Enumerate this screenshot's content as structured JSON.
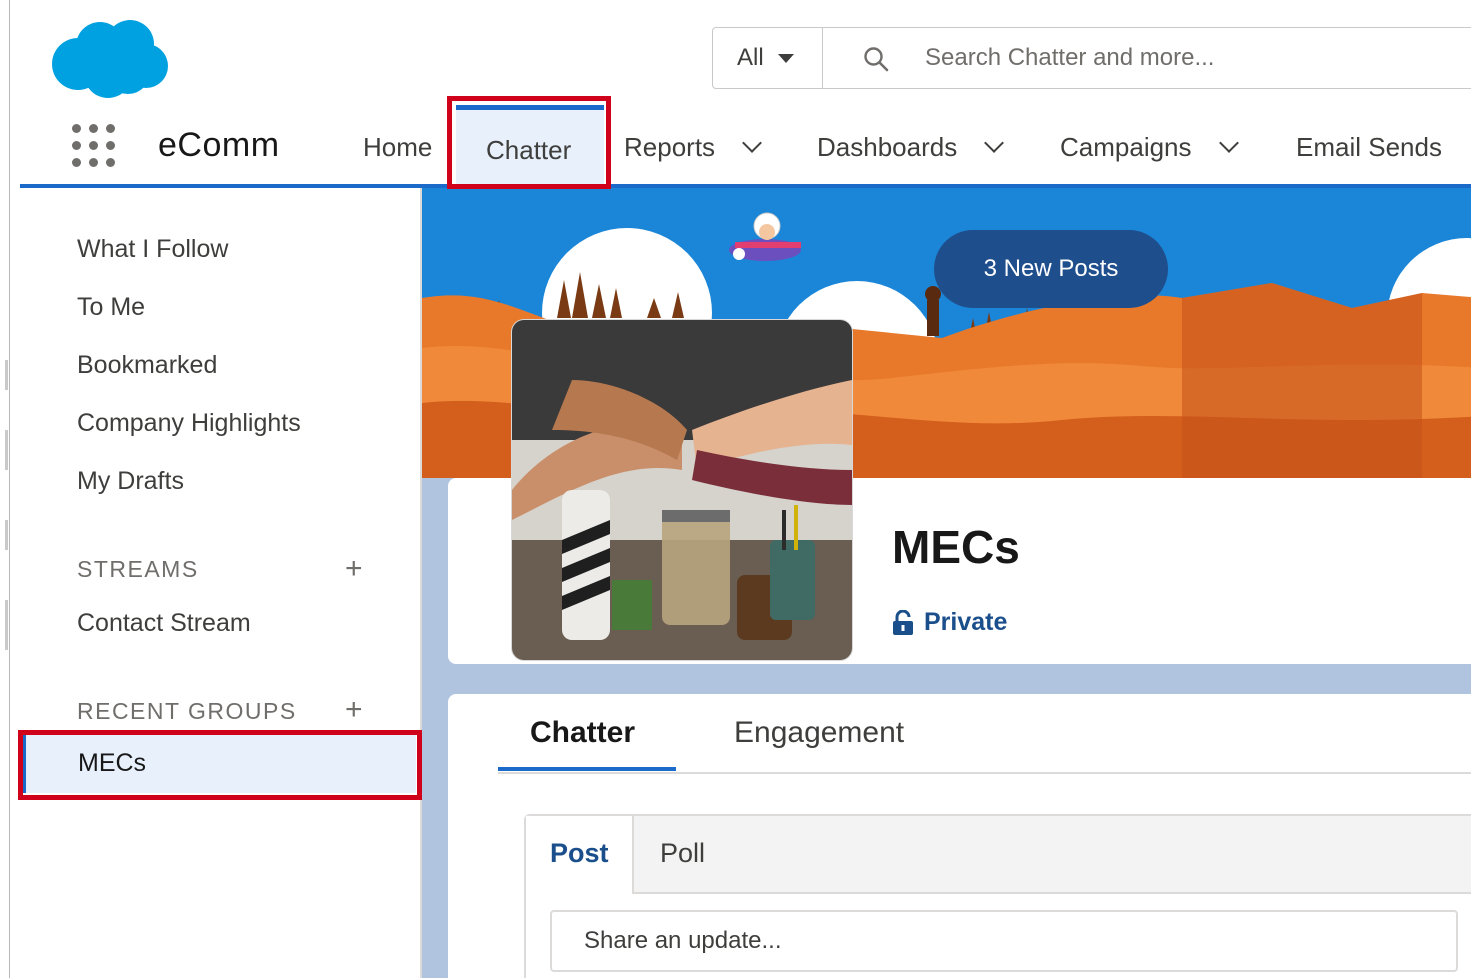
{
  "header": {
    "search_scope": "All",
    "search_placeholder": "Search Chatter and more..."
  },
  "nav": {
    "app_name": "eComm",
    "items": [
      {
        "label": "Home"
      },
      {
        "label": "Chatter",
        "active": true
      },
      {
        "label": "Reports",
        "has_menu": true
      },
      {
        "label": "Dashboards",
        "has_menu": true
      },
      {
        "label": "Campaigns",
        "has_menu": true
      },
      {
        "label": "Email Sends",
        "has_menu": true
      }
    ]
  },
  "sidebar": {
    "links": [
      "What I Follow",
      "To Me",
      "Bookmarked",
      "Company Highlights",
      "My Drafts"
    ],
    "streams_heading": "STREAMS",
    "streams": [
      "Contact Stream"
    ],
    "recent_groups_heading": "RECENT GROUPS",
    "recent_groups": [
      "MECs"
    ]
  },
  "main": {
    "new_posts_label": "3 New Posts",
    "group_name": "MECs",
    "privacy_label": "Private",
    "tabs": [
      "Chatter",
      "Engagement"
    ],
    "publisher_tabs": [
      "Post",
      "Poll"
    ],
    "share_placeholder": "Share an update..."
  },
  "colors": {
    "brand_blue": "#1b6ac9",
    "highlight_red": "#d0021b",
    "salesforce_cloud": "#00a1e0"
  }
}
